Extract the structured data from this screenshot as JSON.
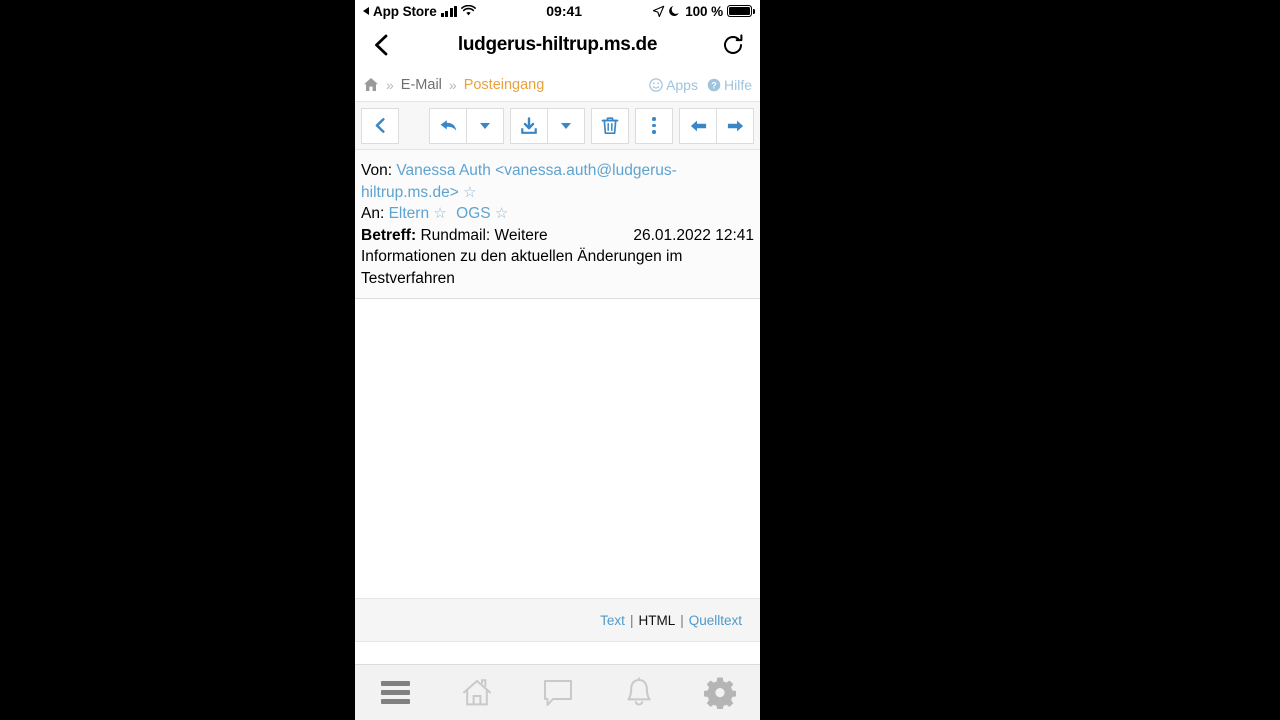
{
  "status_bar": {
    "back_app": "App Store",
    "time": "09:41",
    "battery_percent": "100 %",
    "icons": [
      "back-triangle-icon",
      "signal-bars-icon",
      "wifi-icon",
      "location-arrow-icon",
      "moon-icon",
      "battery-icon"
    ]
  },
  "browser": {
    "url_title": "ludgerus-hiltrup.ms.de",
    "back_icon": "chevron-left-icon",
    "reload_icon": "reload-icon"
  },
  "breadcrumb": {
    "home_icon": "home-icon",
    "separator": "»",
    "items": [
      {
        "label": "E-Mail",
        "current": false
      },
      {
        "label": "Posteingang",
        "current": true
      }
    ],
    "right_links": [
      {
        "label": "Apps",
        "icon": "smiley-icon"
      },
      {
        "label": "Hilfe",
        "icon": "question-circle-icon"
      }
    ]
  },
  "mail_toolbar": {
    "buttons": [
      {
        "name": "back-to-list-button",
        "icon": "chevron-left-icon",
        "title": "Zurück"
      },
      {
        "name": "reply-button",
        "icon": "reply-arrow-icon",
        "title": "Antworten"
      },
      {
        "name": "reply-options-button",
        "icon": "caret-down-icon",
        "title": "Antwort-Optionen"
      },
      {
        "name": "download-button",
        "icon": "download-icon",
        "title": "Herunterladen"
      },
      {
        "name": "download-options-button",
        "icon": "caret-down-icon",
        "title": "Download-Optionen"
      },
      {
        "name": "delete-button",
        "icon": "trash-icon",
        "title": "Löschen"
      },
      {
        "name": "more-button",
        "icon": "vertical-dots-icon",
        "title": "Mehr"
      },
      {
        "name": "previous-mail-button",
        "icon": "arrow-left-icon",
        "title": "Vorherige"
      },
      {
        "name": "next-mail-button",
        "icon": "arrow-right-icon",
        "title": "Nächste"
      }
    ]
  },
  "mail_header": {
    "from_label": "Von:",
    "from_value": "Vanessa Auth <vanessa.auth@ludgerus-hiltrup.ms.de>",
    "from_star": "☆",
    "to_label": "An:",
    "to_recipients": [
      {
        "name": "Eltern",
        "star": "☆"
      },
      {
        "name": "OGS",
        "star": "☆"
      }
    ],
    "subject_label": "Betreff:",
    "subject_value": "Rundmail: Weitere Informationen zu den aktuellen Änderungen im Testverfahren",
    "date": "26.01.2022 12:41"
  },
  "mail_body": {
    "content": ""
  },
  "format_bar": {
    "options": [
      {
        "label": "Text",
        "active": false
      },
      {
        "label": "HTML",
        "active": true
      },
      {
        "label": "Quelltext",
        "active": false
      }
    ],
    "separator": "|"
  },
  "app_nav": {
    "items": [
      {
        "name": "menu-nav-button",
        "icon": "hamburger-icon"
      },
      {
        "name": "home-nav-button",
        "icon": "house-icon"
      },
      {
        "name": "messages-nav-button",
        "icon": "speech-bubble-icon"
      },
      {
        "name": "notifications-nav-button",
        "icon": "bell-icon"
      },
      {
        "name": "settings-nav-button",
        "icon": "gear-icon"
      }
    ]
  },
  "colors": {
    "accent_blue": "#3a87c8",
    "link_blue": "#5fa3cf",
    "breadcrumb_orange": "#e8a33d",
    "nav_gray": "#808080",
    "nav_light_gray": "#c9c9c9"
  }
}
